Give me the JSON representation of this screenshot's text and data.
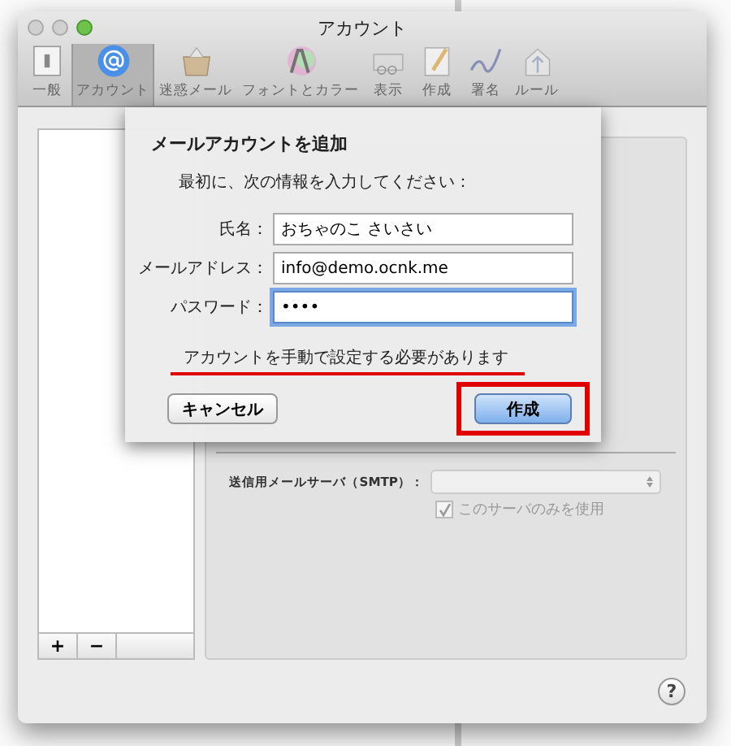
{
  "window": {
    "title": "アカウント"
  },
  "toolbar": [
    {
      "label": "一般",
      "kind": "switch",
      "selected": false
    },
    {
      "label": "アカウント",
      "kind": "at",
      "selected": true
    },
    {
      "label": "迷惑メール",
      "kind": "junk",
      "selected": false
    },
    {
      "label": "フォントとカラー",
      "kind": "font",
      "selected": false
    },
    {
      "label": "表示",
      "kind": "display",
      "selected": false
    },
    {
      "label": "作成",
      "kind": "compose",
      "selected": false
    },
    {
      "label": "署名",
      "kind": "signature",
      "selected": false
    },
    {
      "label": "ルール",
      "kind": "rules",
      "selected": false
    }
  ],
  "account_list": {
    "buttons": [
      "+",
      "−"
    ]
  },
  "server_settings": {
    "smtp_label": "送信用メールサーバ（SMTP）：",
    "only_this_server": {
      "label": "このサーバのみを使用",
      "checked": true,
      "disabled": true
    }
  },
  "sheet": {
    "title": "メールアカウントを追加",
    "subtitle": "最初に、次の情報を入力してください：",
    "fields": [
      {
        "label": "氏名：",
        "value": "おちゃのこ さいさい",
        "focused": false
      },
      {
        "label": "メールアドレス：",
        "value": "info@demo.ocnk.me",
        "focused": false
      },
      {
        "label": "パスワード：",
        "value": "••••",
        "focused": true
      }
    ],
    "message": {
      "text": "アカウントを手動で設定する必要があります",
      "underlined": true
    },
    "buttons": [
      {
        "label": "キャンセル",
        "default": false,
        "highlighted": false
      },
      {
        "label": "作成",
        "default": true,
        "highlighted": true
      }
    ]
  },
  "help": {
    "label": "?"
  }
}
